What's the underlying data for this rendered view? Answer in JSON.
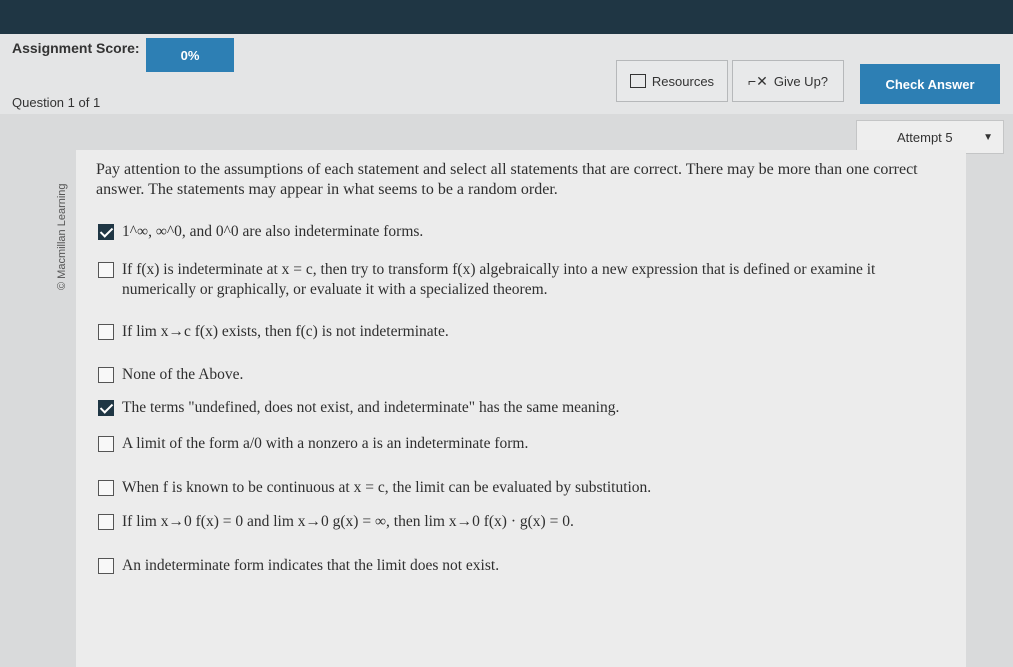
{
  "header": {
    "score_label": "Assignment Score:",
    "score_value": "0%",
    "question_label": "Question 1 of 1",
    "resources_label": "Resources",
    "giveup_label": "Give Up?",
    "check_label": "Check Answer",
    "attempt_label": "Attempt 5"
  },
  "sidebar": {
    "brand": "© Macmillan Learning"
  },
  "question": {
    "instructions": "Pay attention to the assumptions of each statement and select all statements that are correct. There may be more than one correct answer. The statements may appear in what seems to be a random order.",
    "options": [
      {
        "text": "1^∞, ∞^0, and 0^0 are also indeterminate forms.",
        "checked": true
      },
      {
        "text": "If f(x) is indeterminate at x = c, then try to transform f(x) algebraically into a new expression that is defined or examine it numerically or graphically, or evaluate it with a specialized theorem.",
        "checked": false
      },
      {
        "text": "If lim x→c f(x) exists, then f(c) is not indeterminate.",
        "checked": false
      },
      {
        "text": "None of the Above.",
        "checked": false
      },
      {
        "text": "The terms \"undefined, does not exist, and indeterminate\" has the same meaning.",
        "checked": false
      },
      {
        "text": "A limit of the form a/0 with a nonzero a is an indeterminate form.",
        "checked": true
      },
      {
        "text": "When f is known to be continuous at x = c, the limit can be evaluated by substitution.",
        "checked": false
      },
      {
        "text": "If lim x→0 f(x) = 0 and lim x→0 g(x) = ∞, then lim x→0 f(x) · g(x) = 0.",
        "checked": false
      },
      {
        "text": "An indeterminate form indicates that the limit does not exist.",
        "checked": true
      }
    ]
  }
}
